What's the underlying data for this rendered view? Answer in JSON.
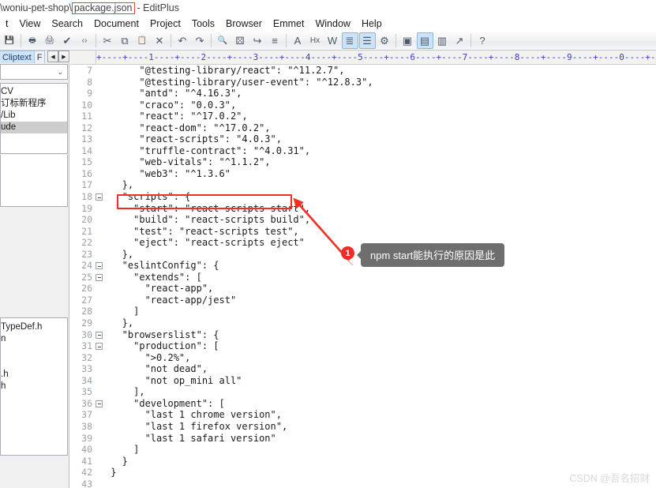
{
  "window": {
    "title_path": "\\woniu-pet-shop\\",
    "title_file": "package.json",
    "title_suffix": "- EditPlus",
    "highlight_color": "#e8413a"
  },
  "menu": {
    "items": [
      {
        "label": "t"
      },
      {
        "label": "View"
      },
      {
        "label": "Search"
      },
      {
        "label": "Document"
      },
      {
        "label": "Project"
      },
      {
        "label": "Tools"
      },
      {
        "label": "Browser"
      },
      {
        "label": "Emmet"
      },
      {
        "label": "Window"
      },
      {
        "label": "Help"
      }
    ]
  },
  "toolbar": {
    "buttons": [
      {
        "name": "save-icon",
        "glyph": "💾",
        "active": false
      },
      {
        "name": "separator"
      },
      {
        "name": "print-preview-icon",
        "glyph": "🖶",
        "active": false
      },
      {
        "name": "print-icon",
        "glyph": "🖨",
        "active": false
      },
      {
        "name": "spellcheck-icon",
        "glyph": "✔",
        "active": false
      },
      {
        "name": "code-tag-icon",
        "glyph": "‹›",
        "active": false
      },
      {
        "name": "separator"
      },
      {
        "name": "cut-scissors-icon",
        "glyph": "✂",
        "active": false
      },
      {
        "name": "copy-icon",
        "glyph": "⧉",
        "active": false
      },
      {
        "name": "paste-clipboard-icon",
        "glyph": "📋",
        "active": false
      },
      {
        "name": "delete-x-icon",
        "glyph": "✕",
        "active": false
      },
      {
        "name": "separator"
      },
      {
        "name": "undo-icon",
        "glyph": "↶",
        "active": false
      },
      {
        "name": "redo-icon",
        "glyph": "↷",
        "active": false
      },
      {
        "name": "separator"
      },
      {
        "name": "find-magnifier-icon",
        "glyph": "🔍",
        "active": false
      },
      {
        "name": "replace-icon",
        "glyph": "⚄",
        "active": false
      },
      {
        "name": "goto-line-icon",
        "glyph": "↪",
        "active": false
      },
      {
        "name": "add-bookmark-icon",
        "glyph": "≡",
        "active": false
      },
      {
        "name": "separator"
      },
      {
        "name": "uppercase-icon",
        "glyph": "A",
        "active": false
      },
      {
        "name": "hex-icon",
        "glyph": "Hx",
        "active": false
      },
      {
        "name": "word-wrap-icon",
        "glyph": "W",
        "active": false
      },
      {
        "name": "indent-icon",
        "glyph": "≣",
        "active": true
      },
      {
        "name": "line-numbers-icon",
        "glyph": "☰",
        "active": true
      },
      {
        "name": "settings-gear-icon",
        "glyph": "⚙",
        "active": false
      },
      {
        "name": "separator"
      },
      {
        "name": "toggle-left-panel-icon",
        "glyph": "▣",
        "active": false
      },
      {
        "name": "toggle-output-panel-icon",
        "glyph": "▤",
        "active": true
      },
      {
        "name": "preview-browser-icon",
        "glyph": "▥",
        "active": false
      },
      {
        "name": "external-browser-icon",
        "glyph": "↗",
        "active": false
      },
      {
        "name": "separator"
      },
      {
        "name": "context-help-icon",
        "glyph": "?",
        "active": false
      }
    ]
  },
  "sidebar": {
    "tabs": [
      {
        "label": "Cliptext",
        "active": true
      },
      {
        "label": "F",
        "active": false
      }
    ],
    "nav_prev": "◀",
    "nav_next": "▶",
    "combo_value": "",
    "combo_caret": "⌄",
    "list_items": [
      {
        "label": "CV",
        "selected": false
      },
      {
        "label": "订标新程序",
        "selected": false
      },
      {
        "label": "/Lib",
        "selected": false
      },
      {
        "label": "ude",
        "selected": true
      }
    ],
    "lower_items": [
      {
        "label": "TypeDef.h"
      },
      {
        "label": "n"
      },
      {
        "label": ""
      },
      {
        "label": ""
      },
      {
        "label": ".h"
      },
      {
        "label": "h"
      }
    ]
  },
  "ruler": {
    "ticks": "+----+----1----+----2----+----3----+----4----+----5----+----6----+----7----+----8----+----9----+----0----+----1-"
  },
  "editor": {
    "lines": [
      {
        "num": "7",
        "fold": false,
        "text": "      \"@testing-library/react\": \"^11.2.7\","
      },
      {
        "num": "8",
        "fold": false,
        "text": "      \"@testing-library/user-event\": \"^12.8.3\","
      },
      {
        "num": "9",
        "fold": false,
        "text": "      \"antd\": \"^4.16.3\","
      },
      {
        "num": "10",
        "fold": false,
        "text": "      \"craco\": \"0.0.3\","
      },
      {
        "num": "11",
        "fold": false,
        "text": "      \"react\": \"^17.0.2\","
      },
      {
        "num": "12",
        "fold": false,
        "text": "      \"react-dom\": \"^17.0.2\","
      },
      {
        "num": "13",
        "fold": false,
        "text": "      \"react-scripts\": \"4.0.3\","
      },
      {
        "num": "14",
        "fold": false,
        "text": "      \"truffle-contract\": \"^4.0.31\","
      },
      {
        "num": "15",
        "fold": false,
        "text": "      \"web-vitals\": \"^1.1.2\","
      },
      {
        "num": "16",
        "fold": false,
        "text": "      \"web3\": \"^1.3.6\""
      },
      {
        "num": "17",
        "fold": false,
        "text": "   },"
      },
      {
        "num": "18",
        "fold": true,
        "text": "   \"scripts\": {"
      },
      {
        "num": "19",
        "fold": false,
        "text": "     \"start\": \"react-scripts start\","
      },
      {
        "num": "20",
        "fold": false,
        "text": "     \"build\": \"react-scripts build\","
      },
      {
        "num": "21",
        "fold": false,
        "text": "     \"test\": \"react-scripts test\","
      },
      {
        "num": "22",
        "fold": false,
        "text": "     \"eject\": \"react-scripts eject\""
      },
      {
        "num": "23",
        "fold": false,
        "text": "   },"
      },
      {
        "num": "24",
        "fold": true,
        "text": "   \"eslintConfig\": {"
      },
      {
        "num": "25",
        "fold": true,
        "text": "     \"extends\": ["
      },
      {
        "num": "26",
        "fold": false,
        "text": "       \"react-app\","
      },
      {
        "num": "27",
        "fold": false,
        "text": "       \"react-app/jest\""
      },
      {
        "num": "28",
        "fold": false,
        "text": "     ]"
      },
      {
        "num": "29",
        "fold": false,
        "text": "   },"
      },
      {
        "num": "30",
        "fold": true,
        "text": "   \"browserslist\": {"
      },
      {
        "num": "31",
        "fold": true,
        "text": "     \"production\": ["
      },
      {
        "num": "32",
        "fold": false,
        "text": "       \">0.2%\","
      },
      {
        "num": "33",
        "fold": false,
        "text": "       \"not dead\","
      },
      {
        "num": "34",
        "fold": false,
        "text": "       \"not op_mini all\""
      },
      {
        "num": "35",
        "fold": false,
        "text": "     ],"
      },
      {
        "num": "36",
        "fold": true,
        "text": "     \"development\": ["
      },
      {
        "num": "37",
        "fold": false,
        "text": "       \"last 1 chrome version\","
      },
      {
        "num": "38",
        "fold": false,
        "text": "       \"last 1 firefox version\","
      },
      {
        "num": "39",
        "fold": false,
        "text": "       \"last 1 safari version\""
      },
      {
        "num": "40",
        "fold": false,
        "text": "     ]"
      },
      {
        "num": "41",
        "fold": false,
        "text": "   }"
      },
      {
        "num": "42",
        "fold": false,
        "text": " }"
      },
      {
        "num": "43",
        "fold": false,
        "text": ""
      }
    ]
  },
  "annotation": {
    "badge": "1",
    "tooltip": "npm start能执行的原因是此",
    "box_color": "#ef2f24",
    "arrow_color": "#ee3124",
    "tooltip_bg": "#6e6e6e"
  },
  "watermark": {
    "text": "CSDN @吾名招财"
  }
}
